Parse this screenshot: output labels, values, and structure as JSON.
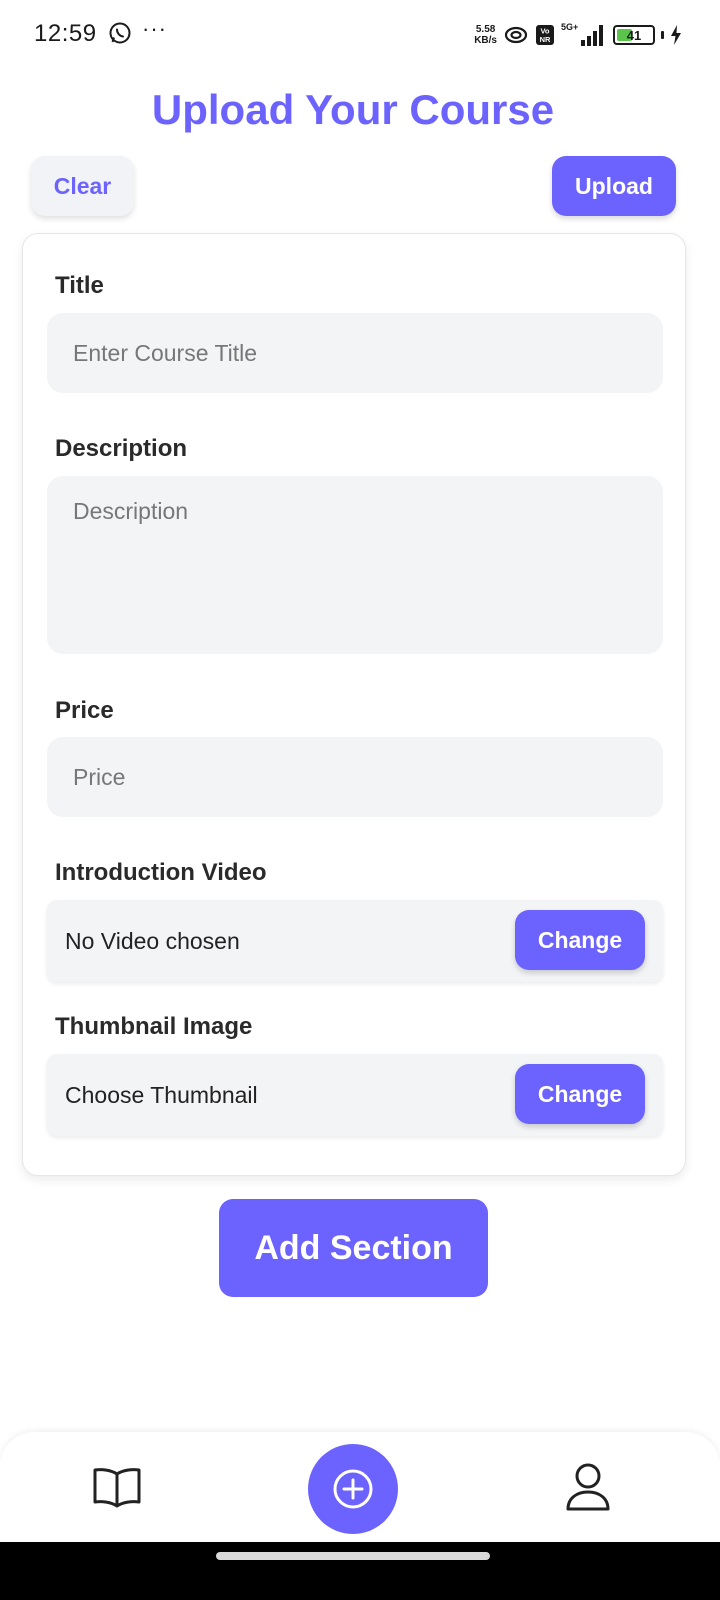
{
  "status_bar": {
    "time": "12:59",
    "more": "···",
    "net_speed_value": "5.58",
    "net_speed_unit": "KB/s",
    "network_type": "5G+",
    "volte_top": "Vo",
    "volte_bottom": "NR",
    "battery_level": "41",
    "battery_color": "#5ac54a"
  },
  "header": {
    "title": "Upload Your Course",
    "clear_label": "Clear",
    "upload_label": "Upload"
  },
  "form": {
    "title_label": "Title",
    "title_placeholder": "Enter Course Title",
    "description_label": "Description",
    "description_placeholder": "Description",
    "price_label": "Price",
    "price_placeholder": "Price",
    "video_label": "Introduction Video",
    "video_status": "No Video chosen",
    "video_change_label": "Change",
    "thumbnail_label": "Thumbnail Image",
    "thumbnail_status": "Choose Thumbnail",
    "thumbnail_change_label": "Change"
  },
  "add_section_label": "Add Section",
  "bottom_nav": {
    "items": [
      {
        "icon": "book-icon"
      },
      {
        "icon": "plus-circle-icon"
      },
      {
        "icon": "user-icon"
      }
    ]
  },
  "colors": {
    "accent": "#6c63ff",
    "field_background": "#f3f4f6"
  }
}
